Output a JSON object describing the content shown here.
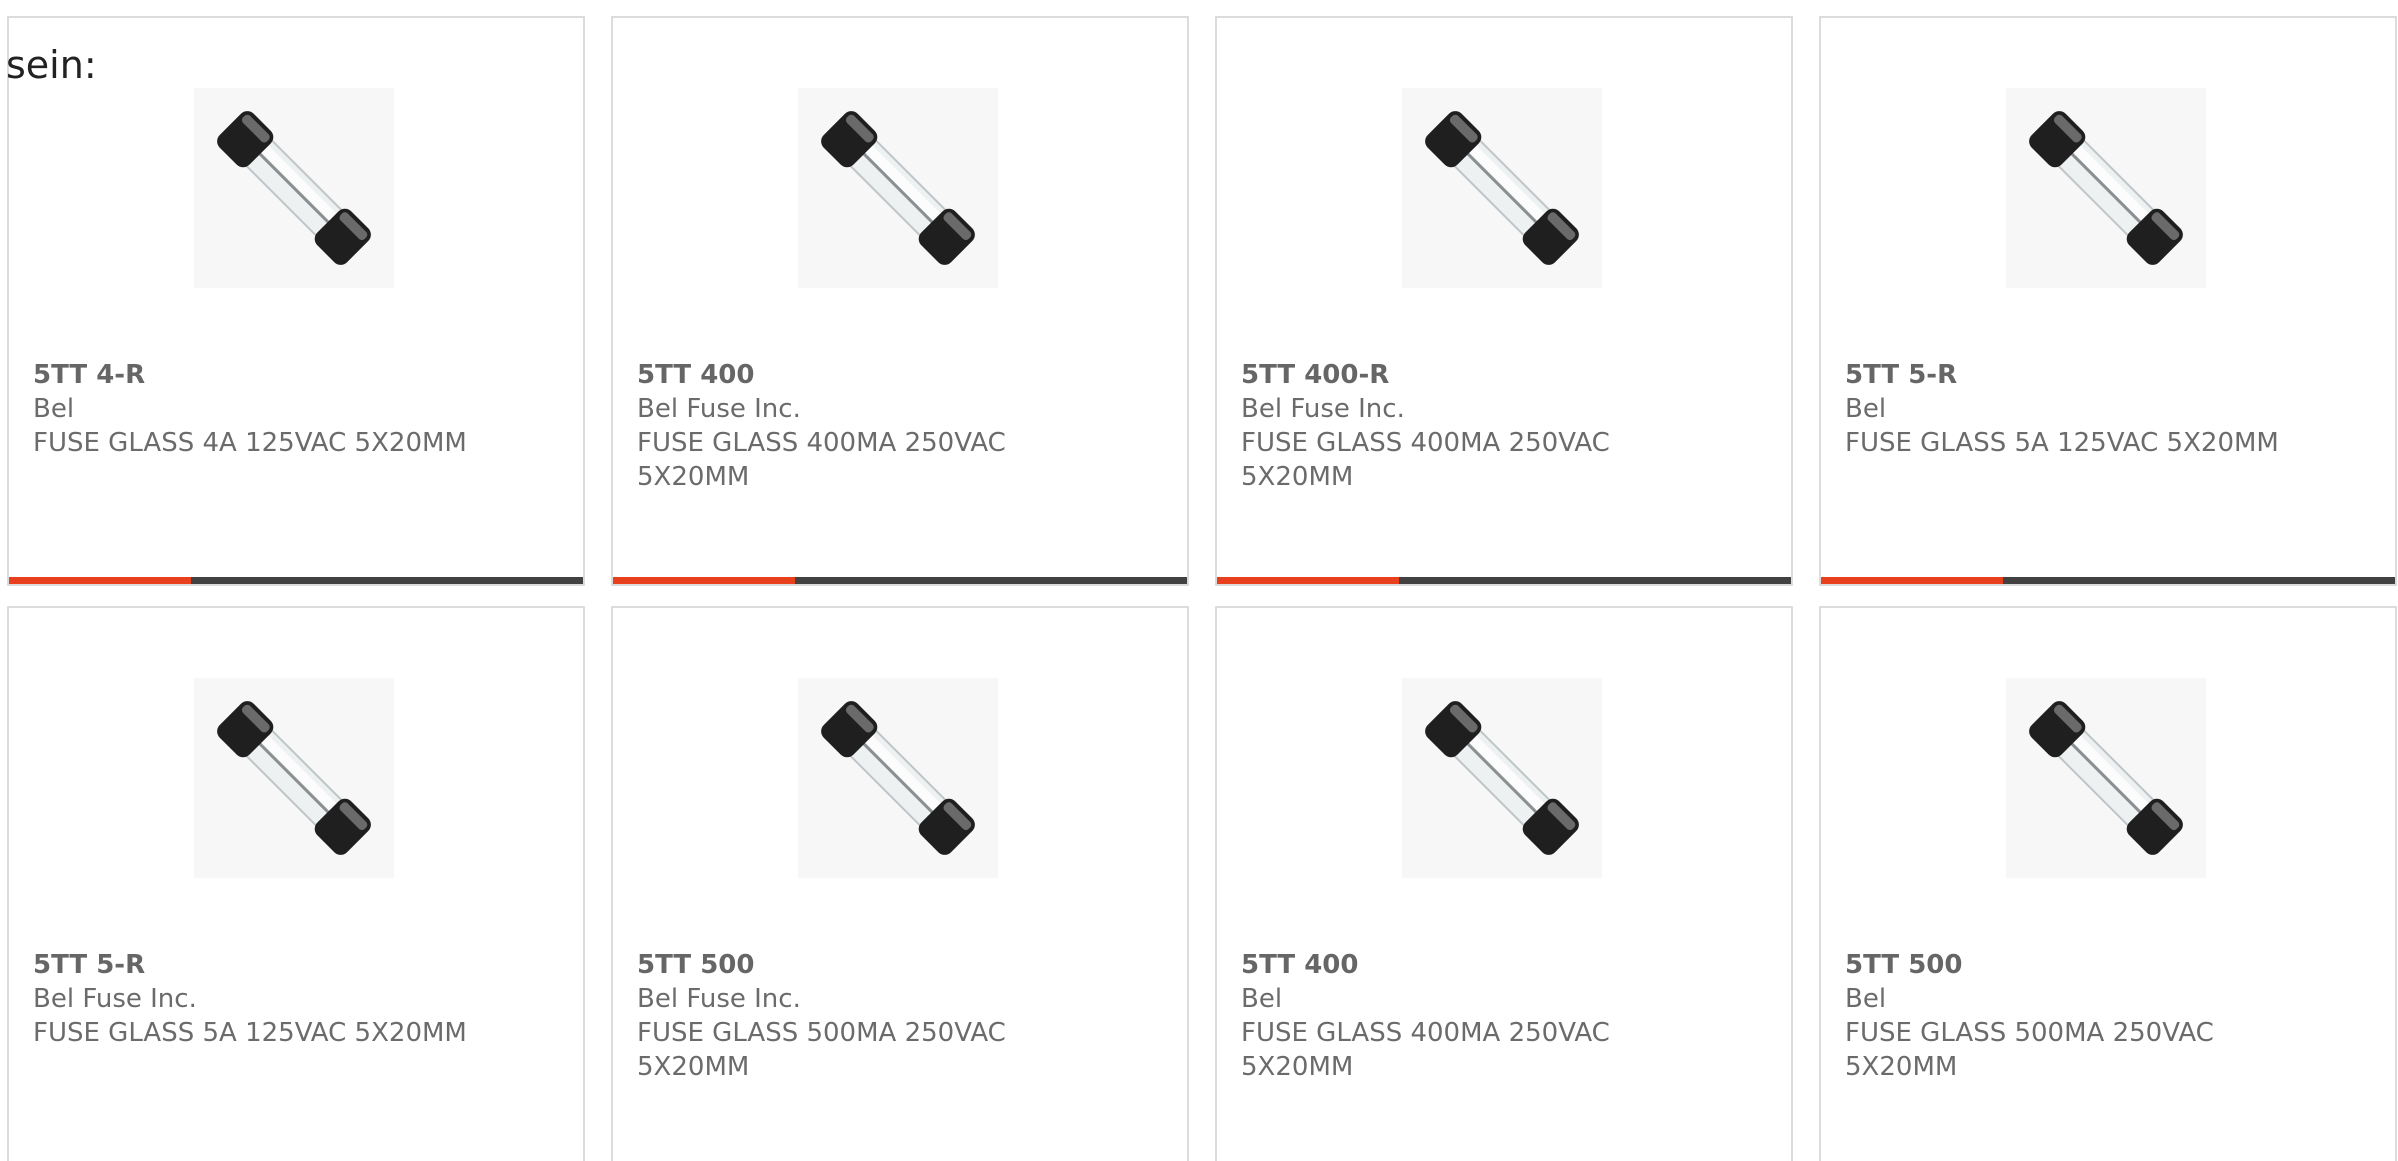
{
  "intro_text": "sein:",
  "colors": {
    "accent": "#e8401c",
    "bar_dark": "#414141",
    "border": "#dcdcdc"
  },
  "products": [
    {
      "part": "5TT 4-R",
      "brand": "Bel",
      "desc": "FUSE GLASS 4A 125VAC 5X20MM",
      "image_icon": "glass-fuse-image"
    },
    {
      "part": "5TT 400",
      "brand": "Bel Fuse Inc.",
      "desc": "FUSE GLASS 400MA 250VAC 5X20MM",
      "image_icon": "glass-fuse-image"
    },
    {
      "part": "5TT 400-R",
      "brand": "Bel Fuse Inc.",
      "desc": "FUSE GLASS 400MA 250VAC 5X20MM",
      "image_icon": "glass-fuse-image"
    },
    {
      "part": "5TT 5-R",
      "brand": "Bel",
      "desc": "FUSE GLASS 5A 125VAC 5X20MM",
      "image_icon": "glass-fuse-image"
    },
    {
      "part": "5TT 5-R",
      "brand": "Bel Fuse Inc.",
      "desc": "FUSE GLASS 5A 125VAC 5X20MM",
      "image_icon": "glass-fuse-image"
    },
    {
      "part": "5TT 500",
      "brand": "Bel Fuse Inc.",
      "desc": "FUSE GLASS 500MA 250VAC 5X20MM",
      "image_icon": "glass-fuse-image"
    },
    {
      "part": "5TT 400",
      "brand": "Bel",
      "desc": "FUSE GLASS 400MA 250VAC 5X20MM",
      "image_icon": "glass-fuse-image"
    },
    {
      "part": "5TT 500",
      "brand": "Bel",
      "desc": "FUSE GLASS 500MA 250VAC 5X20MM",
      "image_icon": "glass-fuse-image"
    }
  ]
}
